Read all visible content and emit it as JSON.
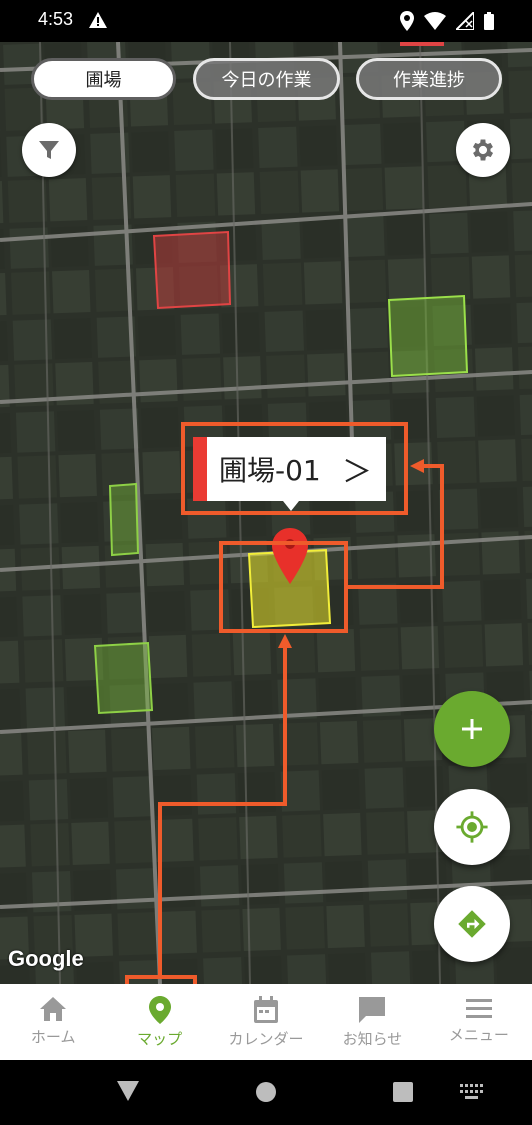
{
  "status_bar": {
    "time": "4:53"
  },
  "tabs": [
    {
      "label": "圃場",
      "active": true
    },
    {
      "label": "今日の作業",
      "active": false
    },
    {
      "label": "作業進捗",
      "active": false
    }
  ],
  "map": {
    "selected_field_label": "圃場-01",
    "selected_field_arrow": "＞",
    "attribution": "Google",
    "colors": {
      "field_red": "#c23b3b",
      "field_green": "#7dc23a",
      "field_yellow": "#e5e02a",
      "marker": "#e8302a",
      "highlight": "#ef5b2b"
    }
  },
  "controls": {
    "filter_icon": "filter-icon",
    "settings_icon": "gear-icon",
    "add_icon": "plus-icon",
    "locate_icon": "my-location-icon",
    "directions_icon": "directions-icon",
    "add_color": "#6aaa2f"
  },
  "bottom_nav": [
    {
      "label": "ホーム",
      "icon": "home-icon",
      "active": false
    },
    {
      "label": "マップ",
      "icon": "map-pin-icon",
      "active": true
    },
    {
      "label": "カレンダー",
      "icon": "calendar-icon",
      "active": false
    },
    {
      "label": "お知らせ",
      "icon": "message-icon",
      "active": false
    },
    {
      "label": "メニュー",
      "icon": "menu-icon",
      "active": false
    }
  ]
}
